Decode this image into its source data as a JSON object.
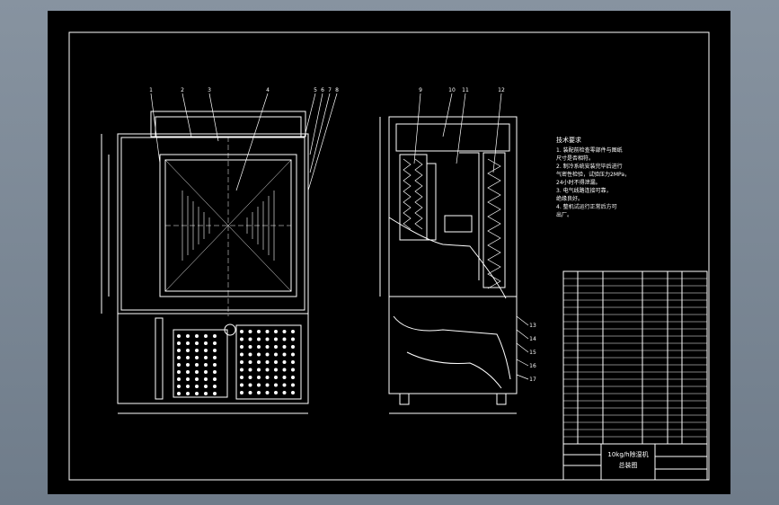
{
  "colors": {
    "background": "#7d8a98",
    "sheet": "#000000",
    "line": "#ffffff",
    "frame": "#ffffff"
  },
  "tech_requirements": {
    "title": "技术要求",
    "lines": [
      "1. 装配前检查零部件与图纸",
      "   尺寸是否相符。",
      "2. 制冷系统安装完毕后进行",
      "   气密性检验，试验压力2MPa，",
      "   24小时不得泄漏。",
      "3. 电气线路连接可靠，",
      "   绝缘良好。",
      "4. 整机试运行正常后方可",
      "   出厂。"
    ]
  },
  "title_block": {
    "name_line1": "10kg/h除湿机",
    "name_line2": "总装图"
  },
  "callouts": {
    "front": [
      "1",
      "2",
      "3",
      "4",
      "5",
      "6",
      "7",
      "8"
    ],
    "side": [
      "9",
      "10",
      "11",
      "12"
    ],
    "right": [
      "13",
      "14",
      "15",
      "16",
      "17"
    ]
  }
}
